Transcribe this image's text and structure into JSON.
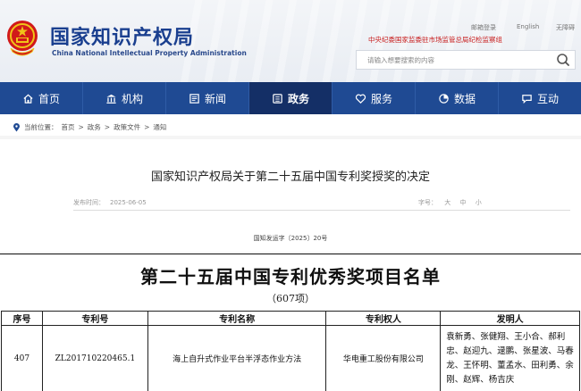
{
  "header": {
    "site_name": "国家知识产权局",
    "site_name_en": "China National Intellectual Property Administration",
    "links": {
      "login": "邮箱登录",
      "english": "English",
      "accessibility": "无障碍"
    },
    "notice": "中央纪委国家监委驻市场监管总局纪检监察组",
    "search": {
      "placeholder": "请输入想要搜索的内容"
    }
  },
  "nav": {
    "items": [
      {
        "label": "首页",
        "icon": "home-icon"
      },
      {
        "label": "机构",
        "icon": "institution-icon"
      },
      {
        "label": "新闻",
        "icon": "news-icon"
      },
      {
        "label": "政务",
        "icon": "government-icon",
        "active": true
      },
      {
        "label": "服务",
        "icon": "service-icon"
      },
      {
        "label": "数据",
        "icon": "data-icon"
      },
      {
        "label": "互动",
        "icon": "interaction-icon"
      }
    ]
  },
  "breadcrumb": {
    "prefix": "当前位置：",
    "items": [
      "首页",
      "政务",
      "政策文件",
      "通知"
    ],
    "separator": ">"
  },
  "article": {
    "title": "国家知识产权局关于第二十五届中国专利奖授奖的决定",
    "date_label": "发布时间：",
    "date": "2025-06-05",
    "font_size_label": "字号：",
    "font_sizes": [
      "大",
      "中",
      "小"
    ],
    "doc_number": "国知发运字〔2025〕20号"
  },
  "award_list": {
    "title": "第二十五届中国专利优秀奖项目名单",
    "count": "（607项）",
    "columns": [
      "序号",
      "专利号",
      "专利名称",
      "专利权人",
      "发明人"
    ],
    "rows": [
      {
        "no": "407",
        "patent_no": "ZL201710220465.1",
        "patent_name": "海上自升式作业平台半浮态作业方法",
        "holder": "华电重工股份有限公司",
        "inventors": "袁新勇、张健翔、王小合、郝利忠、赵迎九、逯鹏、张星波、马春龙、王怀明、董孟水、田利勇、余刚、赵辉、杨吉庆"
      }
    ]
  },
  "colors": {
    "nav_bg": "#1f4a93",
    "nav_active": "#142f66",
    "brand_blue": "#1a3f8f",
    "notice_red": "#c81e1e"
  }
}
